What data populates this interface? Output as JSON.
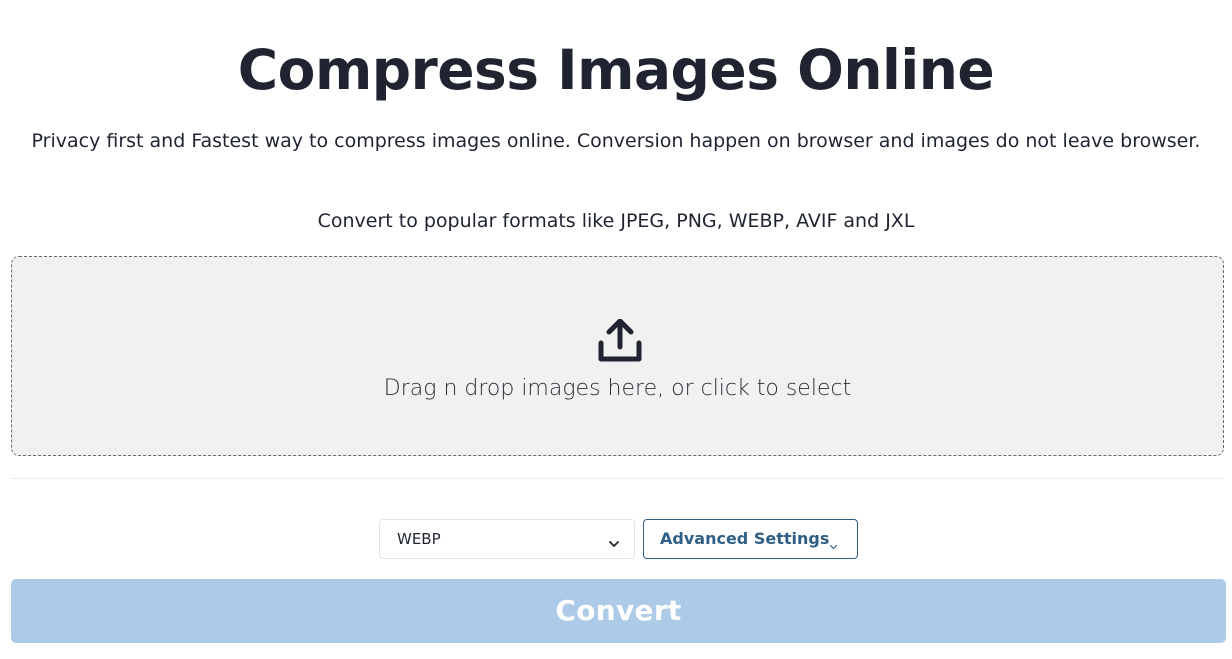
{
  "page": {
    "title": "Compress Images Online",
    "subtitle": "Privacy first and Fastest way to compress images online. Conversion happen on browser and images do not leave browser.",
    "formats_line": "Convert to popular formats like JPEG, PNG, WEBP, AVIF and JXL"
  },
  "dropzone": {
    "icon": "upload-icon",
    "text": "Drag n drop images here, or click to select"
  },
  "controls": {
    "format_select": {
      "value": "WEBP",
      "icon": "chevron-down-icon"
    },
    "advanced_settings": {
      "label": "Advanced Settings",
      "icon": "chevron-down-icon"
    }
  },
  "convert": {
    "label": "Convert",
    "disabled": true
  },
  "colors": {
    "text": "#1f2430",
    "accent": "#2f5f86",
    "dropzone_bg": "#f1f1f1",
    "convert_disabled_bg": "#adcbe8"
  }
}
